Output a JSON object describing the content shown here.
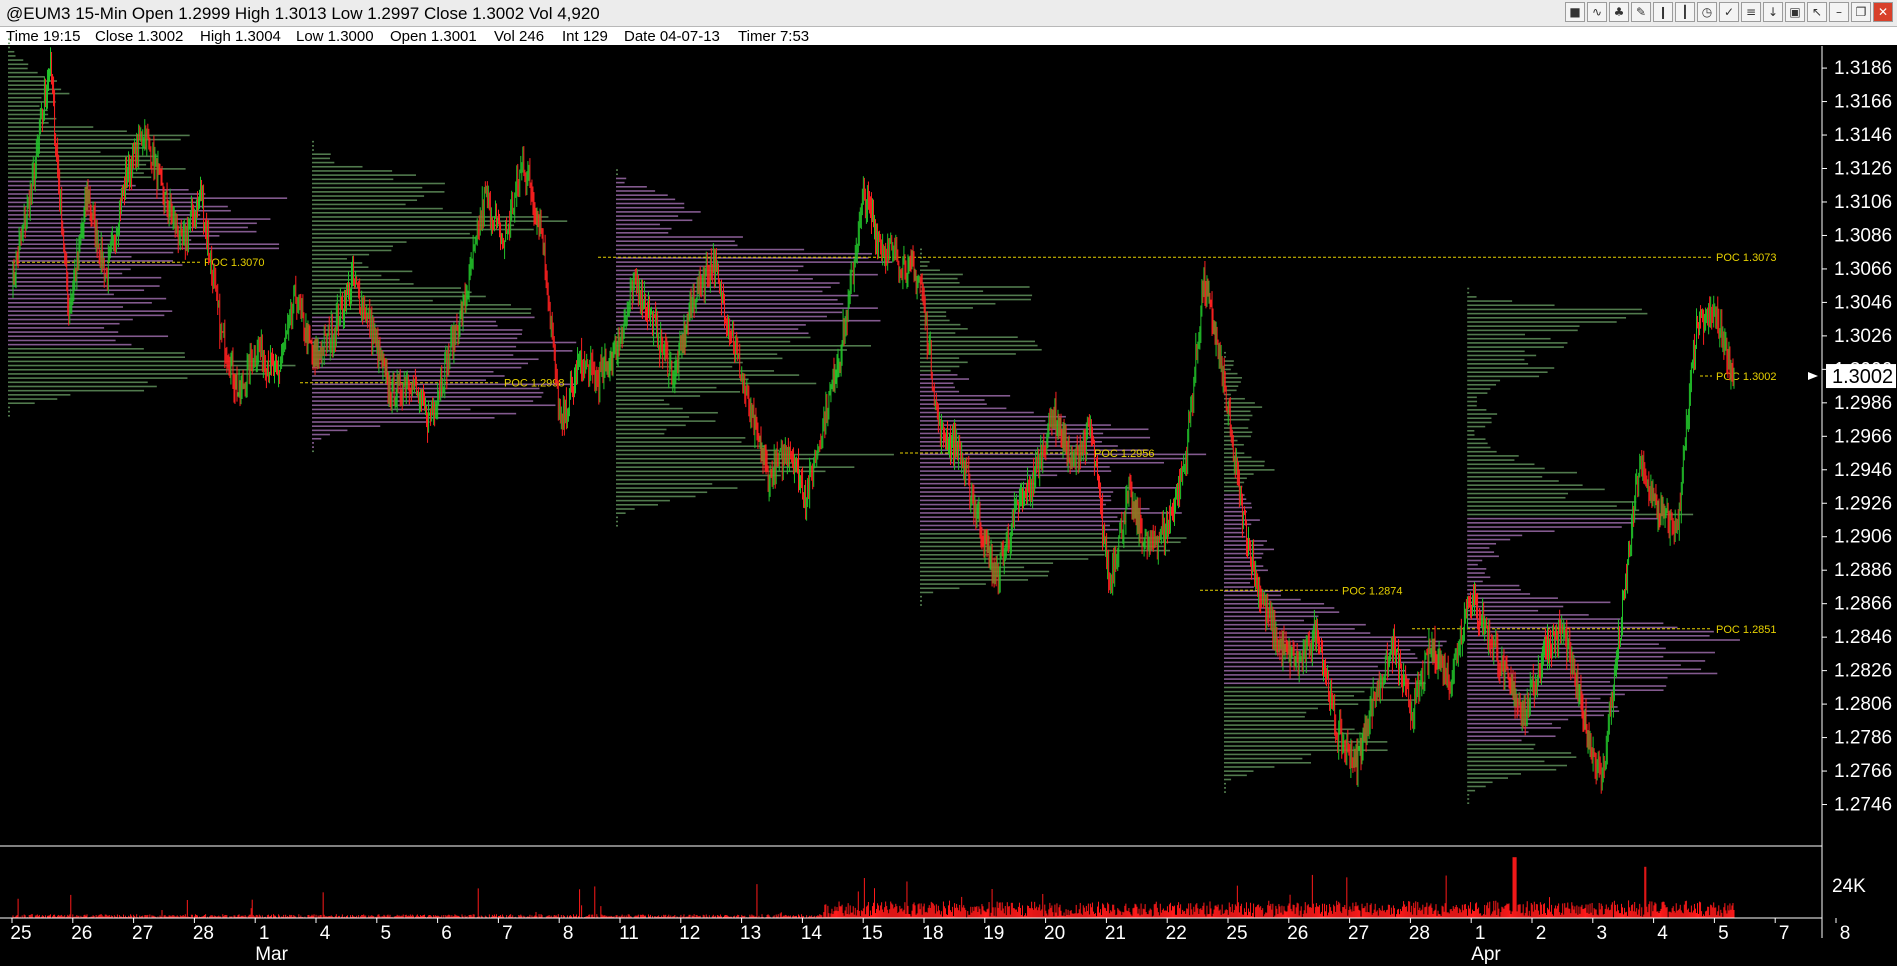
{
  "title": "@EUM3 15-Min Open 1.2999 High 1.3013 Low 1.2997 Close 1.3002 Vol 4,920",
  "databar": [
    "Time 19:15",
    "Close 1.3002",
    "High 1.3004",
    "Low 1.3000",
    "Open 1.3001",
    "Vol 246",
    "Int 129",
    "Date 04-07-13",
    "Timer 7:53"
  ],
  "toolbar_icons": [
    "color-icon",
    "wave-icon",
    "tree-icon",
    "pencil-icon",
    "bar-icon",
    "candle-icon",
    "clock-icon",
    "check-icon",
    "fib-icon",
    "arrow-down-icon",
    "trash-icon",
    "cursor-icon",
    "minimize-icon",
    "restore-icon",
    "close-icon"
  ],
  "colors": {
    "up": "#22c22a",
    "down": "#ff2020",
    "profile_purple": "#9a6aa8",
    "profile_green": "#5f8f5a",
    "poc": "#e6d000",
    "volume": "#ff1a1a",
    "axis": "#ffffff"
  },
  "chart_data": {
    "type": "candlestick",
    "timeframe": "15-Min",
    "ylim": [
      1.2726,
      1.3198
    ],
    "y_ticks": [
      1.3186,
      1.3166,
      1.3146,
      1.3126,
      1.3106,
      1.3086,
      1.3066,
      1.3046,
      1.3026,
      1.3006,
      1.2986,
      1.2966,
      1.2946,
      1.2926,
      1.2906,
      1.2886,
      1.2866,
      1.2846,
      1.2826,
      1.2806,
      1.2786,
      1.2766,
      1.2746
    ],
    "last_price": "1.3002",
    "day_labels": [
      "25",
      "26",
      "27",
      "28",
      "1",
      "4",
      "5",
      "6",
      "7",
      "8",
      "11",
      "12",
      "13",
      "14",
      "15",
      "18",
      "19",
      "20",
      "21",
      "22",
      "25",
      "26",
      "27",
      "28",
      "1",
      "2",
      "3",
      "4",
      "5",
      "7",
      "8"
    ],
    "month_labels": [
      {
        "label": "Mar",
        "day_index": 4
      },
      {
        "label": "Apr",
        "day_index": 24
      }
    ],
    "price_path": [
      1.306,
      1.311,
      1.319,
      1.304,
      1.311,
      1.306,
      1.312,
      1.315,
      1.311,
      1.308,
      1.311,
      1.303,
      1.299,
      1.302,
      1.3,
      1.305,
      1.301,
      1.303,
      1.306,
      1.303,
      1.299,
      1.3,
      1.2975,
      1.301,
      1.305,
      1.311,
      1.308,
      1.313,
      1.309,
      1.297,
      1.301,
      1.3,
      1.302,
      1.306,
      1.303,
      1.3,
      1.305,
      1.307,
      1.303,
      1.298,
      1.294,
      1.296,
      1.293,
      1.298,
      1.303,
      1.311,
      1.308,
      1.307,
      1.306,
      1.297,
      1.296,
      1.292,
      1.288,
      1.292,
      1.294,
      1.298,
      1.295,
      1.297,
      1.288,
      1.293,
      1.29,
      1.291,
      1.295,
      1.306,
      1.3,
      1.292,
      1.287,
      1.284,
      1.283,
      1.285,
      1.279,
      1.277,
      1.281,
      1.284,
      1.28,
      1.284,
      1.282,
      1.287,
      1.285,
      1.282,
      1.28,
      1.284,
      1.285,
      1.28,
      1.276,
      1.285,
      1.295,
      1.292,
      1.291,
      1.303,
      1.304,
      1.3002
    ],
    "poc_lines": [
      {
        "label": "POC 1.3070",
        "price": 1.307
      },
      {
        "label": "POC 1.2998",
        "price": 1.2998
      },
      {
        "label": "POC 1.3073",
        "price": 1.3073
      },
      {
        "label": "POC 1.2956",
        "price": 1.2956
      },
      {
        "label": "POC 1.2874",
        "price": 1.2874
      },
      {
        "label": "POC 1.2851",
        "price": 1.2851
      },
      {
        "label": "POC 1.3002",
        "price": 1.3002
      }
    ],
    "volume_axis_label": "24K",
    "volume_max": 24000
  }
}
